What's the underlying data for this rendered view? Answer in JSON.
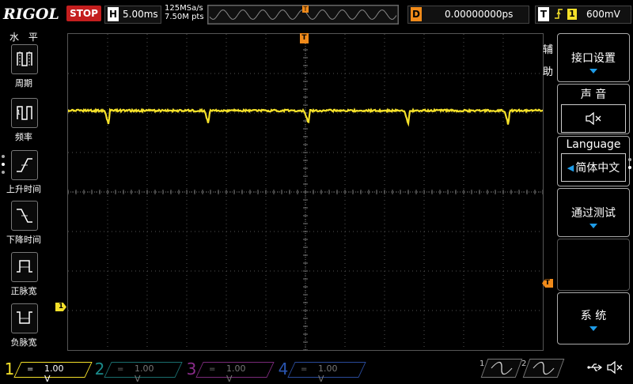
{
  "header": {
    "brand": "RIGOL",
    "run_status": "STOP",
    "timebase_letter": "H",
    "timebase": "5.00ms",
    "sample_rate": "125MSa/s",
    "memory_depth": "7.50M pts",
    "trigger_pos_marker": "T",
    "delay_letter": "D",
    "delay": "0.00000000ps",
    "trigger_letter": "T",
    "trigger_source": "1",
    "trigger_level": "600mV",
    "trigger_edge_icon": "rising-edge-icon"
  },
  "left_menu": {
    "title": "水 平",
    "items": [
      {
        "label": "周期",
        "icon": "period-icon"
      },
      {
        "label": "频率",
        "icon": "frequency-icon"
      },
      {
        "label": "上升时间",
        "icon": "rise-time-icon"
      },
      {
        "label": "下降时间",
        "icon": "fall-time-icon"
      },
      {
        "label": "正脉宽",
        "icon": "positive-width-icon"
      },
      {
        "label": "负脉宽",
        "icon": "negative-width-icon"
      }
    ]
  },
  "screen": {
    "trigger_marker": "T",
    "trigger_level_marker": "T",
    "channel1_marker": "1",
    "waveform_color": "#f5e12a",
    "grid_color": "#555555"
  },
  "right_menu": {
    "title": "辅助",
    "interface_settings": "接口设置",
    "sound": "声 音",
    "sound_icon": "speaker-mute-icon",
    "language": "Language",
    "language_value": "简体中文",
    "pass_fail": "通过测试",
    "system": "系 统"
  },
  "bottom": {
    "channels": [
      {
        "num": "1",
        "coupling": "=",
        "scale": "1.00 V",
        "color": "#f5e12a"
      },
      {
        "num": "2",
        "coupling": "=",
        "scale": "1.00 V",
        "color": "#1a8a8a"
      },
      {
        "num": "3",
        "coupling": "=",
        "scale": "1.00 V",
        "color": "#8a2c8a"
      },
      {
        "num": "4",
        "coupling": "=",
        "scale": "1.00 V",
        "color": "#2a55b0"
      }
    ],
    "gen1": "1",
    "gen2": "2",
    "usb_icon": "usb-icon",
    "speaker_icon": "speaker-mute-icon"
  }
}
